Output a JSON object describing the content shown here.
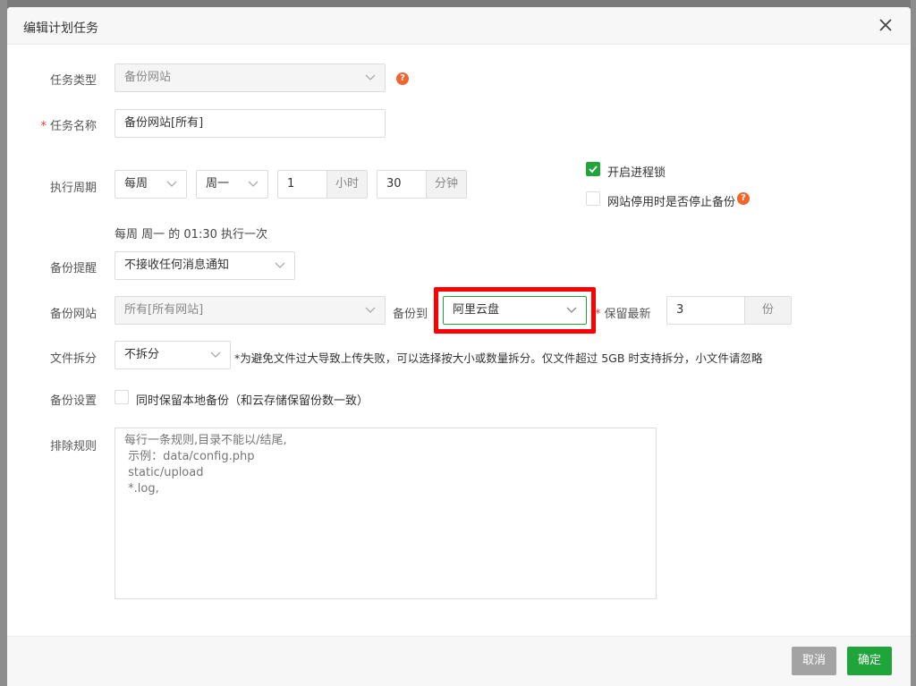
{
  "dialog": {
    "title": "编辑计划任务",
    "close_icon": "close-icon"
  },
  "colors": {
    "accent": "#20a53a",
    "danger": "#ff0000",
    "help": "#f0642d",
    "cancel": "#a3a3a3"
  },
  "task_type": {
    "label": "任务类型",
    "value": "备份网站"
  },
  "task_name": {
    "required_mark": "*",
    "label": "任务名称",
    "value": "备份网站[所有]"
  },
  "schedule": {
    "label": "执行周期",
    "period": "每周",
    "weekday": "周一",
    "hour": "1",
    "hour_unit": "小时",
    "minute": "30",
    "minute_unit": "分钟",
    "summary": "每周 周一 的 01:30 执行一次"
  },
  "options": {
    "process_lock": {
      "label": "开启进程锁",
      "checked": true
    },
    "stop_backup": {
      "label": "网站停用时是否停止备份",
      "checked": false
    }
  },
  "notify": {
    "label": "备份提醒",
    "value": "不接收任何消息通知"
  },
  "backup_site": {
    "label": "备份网站",
    "value": "所有[所有网站]",
    "to_label": "备份到",
    "destination": "阿里云盘",
    "keep_required": "*",
    "keep_label": "保留最新",
    "keep_value": "3",
    "keep_unit": "份"
  },
  "split": {
    "label": "文件拆分",
    "value": "不拆分",
    "hint": "*为避免文件过大导致上传失败，可以选择按大小或数量拆分。仅文件超过 5GB 时支持拆分，小文件请忽略"
  },
  "backup_settings": {
    "label": "备份设置",
    "local_label": "同时保留本地备份（和云存储保留份数一致）",
    "local_checked": false
  },
  "exclude": {
    "label": "排除规则",
    "placeholder": "每行一条规则,目录不能以/结尾,\n 示例：data/config.php\n static/upload\n *.log,"
  },
  "footer": {
    "cancel": "取消",
    "confirm": "确定"
  }
}
